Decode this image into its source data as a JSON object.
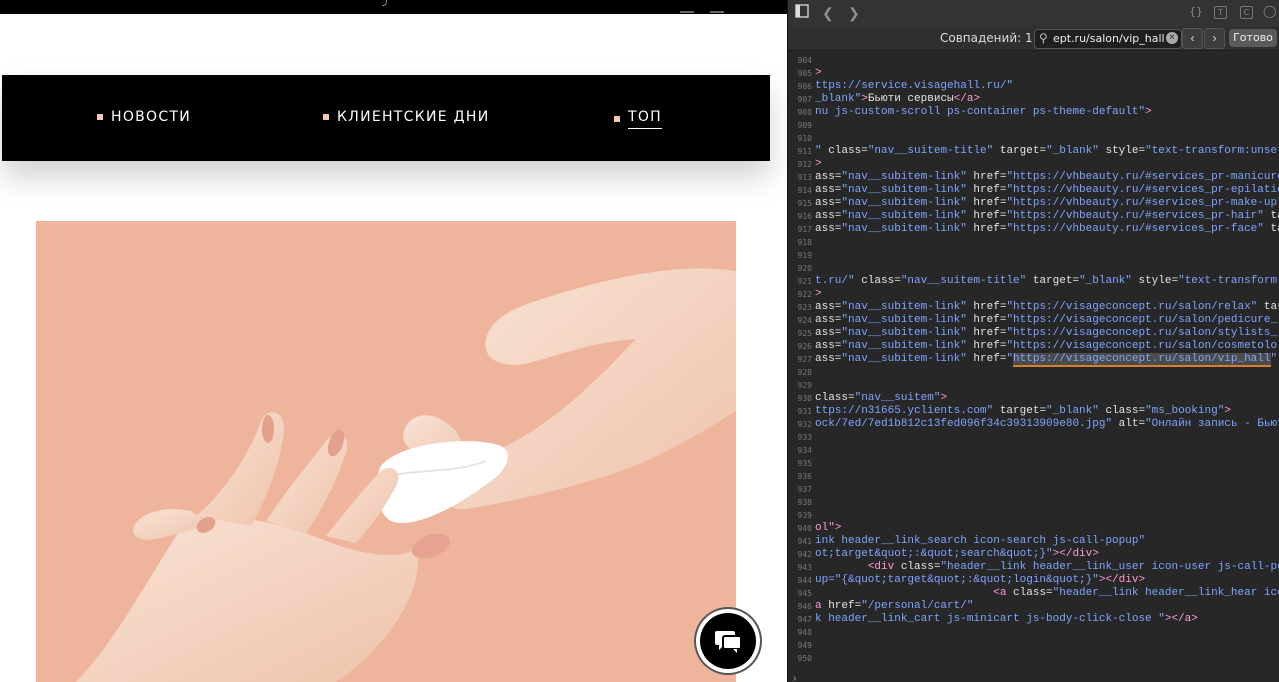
{
  "site": {
    "nav": [
      {
        "label": "НОВОСТИ",
        "active": false
      },
      {
        "label": "КЛИЕНТСКИЕ ДНИ",
        "active": false
      },
      {
        "label": "ТОП",
        "active": true
      }
    ],
    "bullet_color": "#f2c8b0",
    "photo_bg": "#efb59c"
  },
  "devtools": {
    "matches_label": "Совпадений: 1",
    "search_value": "ept.ru/salon/vip_hall",
    "done_label": "Готово",
    "lines": [
      {
        "n": "904",
        "html": ""
      },
      {
        "n": "905",
        "html": "<span class='t'>&gt;</span>"
      },
      {
        "n": "906",
        "html": "<span class='s'>ttps://service.visagehall.ru/\"</span>"
      },
      {
        "n": "907",
        "html": "<span class='s'>_blank\"</span><span class='t'>&gt;</span>Бьюти сервисы<span class='t'>&lt;/a&gt;</span>"
      },
      {
        "n": "908",
        "html": "<span class='s'>nu js-custom-scroll ps-container ps-theme-default\"</span><span class='t'>&gt;</span>"
      },
      {
        "n": "909",
        "html": ""
      },
      {
        "n": "910",
        "html": ""
      },
      {
        "n": "911",
        "html": "<span class='s'>\"</span> class=<span class='s'>\"nav__suitem-title\"</span> target=<span class='s'>\"_blank\"</span> style=<span class='s'>\"text-transform:unset</span>"
      },
      {
        "n": "912",
        "html": "<span class='t'>&gt;</span>"
      },
      {
        "n": "913",
        "html": "ass=<span class='s'>\"nav__subitem-link\"</span> href=<span class='s'>\"https://vhbeauty.ru/#services_pr-manicure</span>"
      },
      {
        "n": "914",
        "html": "ass=<span class='s'>\"nav__subitem-link\"</span> href=<span class='s'>\"https://vhbeauty.ru/#services_pr-epilatio</span>"
      },
      {
        "n": "915",
        "html": "ass=<span class='s'>\"nav__subitem-link\"</span> href=<span class='s'>\"https://vhbeauty.ru/#services_pr-make-up\"</span>"
      },
      {
        "n": "916",
        "html": "ass=<span class='s'>\"nav__subitem-link\"</span> href=<span class='s'>\"https://vhbeauty.ru/#services_pr-hair\"</span> ta"
      },
      {
        "n": "917",
        "html": "ass=<span class='s'>\"nav__subitem-link\"</span> href=<span class='s'>\"https://vhbeauty.ru/#services_pr-face\"</span> ta"
      },
      {
        "n": "918",
        "html": ""
      },
      {
        "n": "919",
        "html": ""
      },
      {
        "n": "920",
        "html": ""
      },
      {
        "n": "921",
        "html": "<span class='s'>t.ru/\"</span> class=<span class='s'>\"nav__suitem-title\"</span> target=<span class='s'>\"_blank\"</span> style=<span class='s'>\"text-transform:</span>"
      },
      {
        "n": "922",
        "html": "<span class='t'>&gt;</span>"
      },
      {
        "n": "923",
        "html": "ass=<span class='s'>\"nav__subitem-link\"</span> href=<span class='s'>\"https://visageconcept.ru/salon/relax\"</span> tar"
      },
      {
        "n": "924",
        "html": "ass=<span class='s'>\"nav__subitem-link\"</span> href=<span class='s'>\"https://visageconcept.ru/salon/pedicure_</span>"
      },
      {
        "n": "925",
        "html": "ass=<span class='s'>\"nav__subitem-link\"</span> href=<span class='s'>\"https://visageconcept.ru/salon/stylists_</span>"
      },
      {
        "n": "926",
        "html": "ass=<span class='s'>\"nav__subitem-link\"</span> href=<span class='s'>\"https://visageconcept.ru/salon/cosmetolo</span>"
      },
      {
        "n": "927",
        "html": "ass=<span class='s'>\"nav__subitem-link\"</span> href=<span class='s'>\"<span class='hl'>https://visageconcept.ru/salon/vip_hall</span>\"</span>"
      },
      {
        "n": "928",
        "html": ""
      },
      {
        "n": "929",
        "html": ""
      },
      {
        "n": "930",
        "html": "class=<span class='s'>\"nav__suitem\"</span><span class='t'>&gt;</span>"
      },
      {
        "n": "931",
        "html": "<span class='s'>ttps://n31665.yclients.com\"</span> target=<span class='s'>\"_blank\"</span> class=<span class='s'>\"ms_booking\"</span><span class='t'>&gt;</span>"
      },
      {
        "n": "932",
        "html": "<span class='s'>ock/7ed/7ed1b812c13fed096f34c39313909e80.jpg\"</span> alt=<span class='s'>\"Онлайн запись - Бьют</span>"
      },
      {
        "n": "933",
        "html": ""
      },
      {
        "n": "934",
        "html": ""
      },
      {
        "n": "935",
        "html": ""
      },
      {
        "n": "936",
        "html": ""
      },
      {
        "n": "937",
        "html": ""
      },
      {
        "n": "938",
        "html": ""
      },
      {
        "n": "939",
        "html": ""
      },
      {
        "n": "940",
        "html": "<span class='t'>ol\"&gt;</span>"
      },
      {
        "n": "941",
        "html": "<span class='s'>ink header__link_search icon-search js-call-popup\"</span>"
      },
      {
        "n": "942",
        "html": "<span class='s'>ot;target&amp;quot;:&amp;quot;search&amp;quot;}\"</span><span class='t'>&gt;&lt;/div&gt;</span>"
      },
      {
        "n": "943",
        "html": "        <span class='t'>&lt;div</span> class=<span class='s'>\"header__link header__link_user icon-user js-call-pop</span>"
      },
      {
        "n": "944",
        "html": "<span class='s'>up=\"{&amp;quot;target&amp;quot;:&amp;quot;login&amp;quot;}\"</span><span class='t'>&gt;&lt;/div&gt;</span>"
      },
      {
        "n": "945",
        "html": "                           <span class='t'>&lt;a</span> class=<span class='s'>\"header__link header__link_hear icon-he</span>"
      },
      {
        "n": "946",
        "html": "<span class='t'>a</span> href=<span class='s'>\"/personal/cart/\"</span>"
      },
      {
        "n": "947",
        "html": "<span class='s'>k header__link_cart js-minicart js-body-click-close \"</span><span class='t'>&gt;&lt;/a&gt;</span>"
      },
      {
        "n": "948",
        "html": ""
      },
      {
        "n": "949",
        "html": ""
      },
      {
        "n": "950",
        "html": ""
      }
    ]
  }
}
